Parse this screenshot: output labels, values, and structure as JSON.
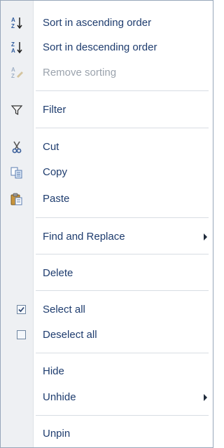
{
  "menu": {
    "items": [
      {
        "label": "Sort in ascending order",
        "icon": "sort-ascending-icon"
      },
      {
        "label": "Sort in descending order",
        "icon": "sort-descending-icon"
      },
      {
        "label": "Remove sorting",
        "icon": "remove-sorting-icon",
        "disabled": true
      },
      {
        "label": "Filter",
        "icon": "filter-icon"
      },
      {
        "label": "Cut",
        "icon": "cut-icon"
      },
      {
        "label": "Copy",
        "icon": "copy-icon"
      },
      {
        "label": "Paste",
        "icon": "paste-icon"
      },
      {
        "label": "Find and Replace",
        "has_submenu": true
      },
      {
        "label": "Delete"
      },
      {
        "label": "Select all",
        "checked": true
      },
      {
        "label": "Deselect all",
        "checked": false
      },
      {
        "label": "Hide"
      },
      {
        "label": "Unhide",
        "has_submenu": true
      },
      {
        "label": "Unpin"
      }
    ],
    "sort_icon_glyphs": {
      "a": "A",
      "z": "Z"
    }
  },
  "colors": {
    "text": "#1e3c6e",
    "disabled_text": "#9ba3ad",
    "gutter": "#eef0f3",
    "border": "#97a7ba",
    "separator": "#d8dde3"
  }
}
